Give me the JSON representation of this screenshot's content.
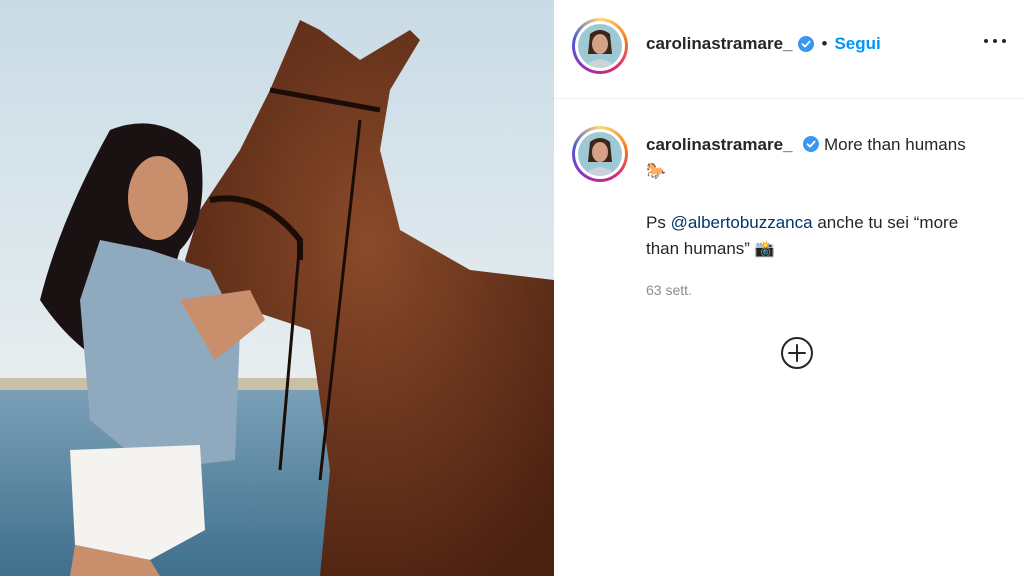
{
  "post": {
    "author": "carolinastramare_",
    "dot": "•",
    "follow_label": "Segui",
    "more_icon": "more-options-icon"
  },
  "caption": {
    "author": "carolinastramare_",
    "text_line1": "More than",
    "text_line2": "humans",
    "emoji_horse": "🐎",
    "ps_prefix": "Ps",
    "mention": "@albertobuzzanca",
    "ps_suffix": "anche tu sei",
    "quote": "“more than humans”",
    "emoji_camera": "📸"
  },
  "timestamp": "63 sett.",
  "colors": {
    "link_blue": "#0095f6",
    "mention": "#00376b",
    "verified": "#3897f0",
    "muted": "#8e8e8e"
  }
}
